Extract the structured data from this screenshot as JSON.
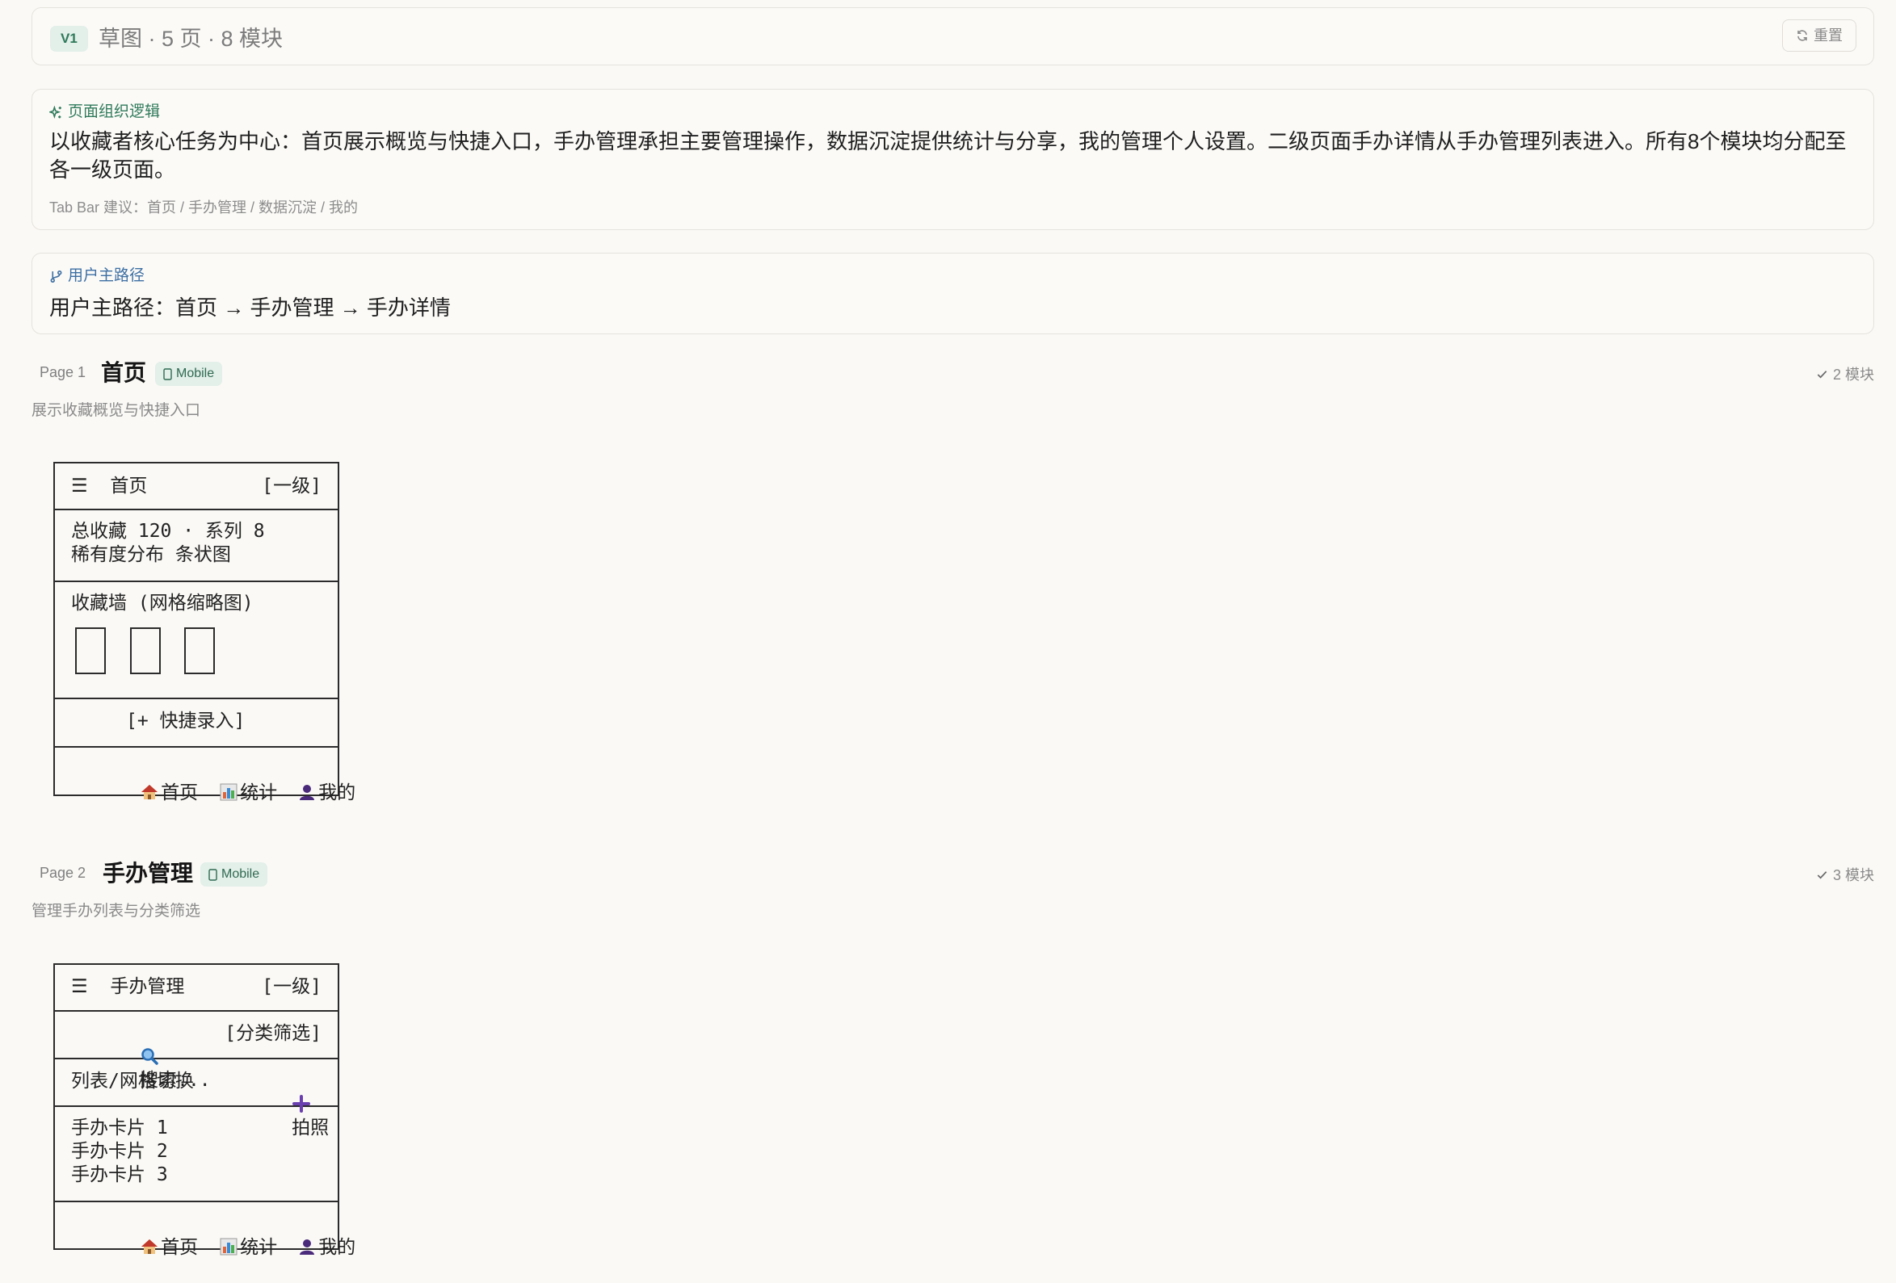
{
  "topbar": {
    "version": "V1",
    "title": "草图 · 5 页 · 8 模块",
    "reset_label": "重置"
  },
  "logic": {
    "heading": "页面组织逻辑",
    "body": "以收藏者核心任务为中心：首页展示概览与快捷入口，手办管理承担主要管理操作，数据沉淀提供统计与分享，我的管理个人设置。二级页面手办详情从手办管理列表进入。所有8个模块均分配至各一级页面。",
    "tab_hint": "Tab Bar 建议：首页 / 手办管理 / 数据沉淀 / 我的"
  },
  "user_path": {
    "heading": "用户主路径",
    "body": "用户主路径：首页 → 手办管理 → 手办详情"
  },
  "pages": [
    {
      "num": "Page 1",
      "name": "首页",
      "badge": "Mobile",
      "module_count": "2 模块",
      "desc": "展示收藏概览与快捷入口",
      "wire": {
        "header_title": "☰  首页",
        "header_level": "[一级]",
        "stats_line1": "总收藏 120 · 系列 8",
        "stats_line2": "稀有度分布 条状图",
        "wall_title": "收藏墙 (网格缩略图)",
        "quick_entry": "[+ 快捷录入]",
        "tab_home": "首页",
        "tab_stats": "统计",
        "tab_me": "我的"
      }
    },
    {
      "num": "Page 2",
      "name": "手办管理",
      "badge": "Mobile",
      "module_count": "3 模块",
      "desc": "管理手办列表与分类筛选",
      "wire": {
        "header_title": "☰  手办管理",
        "header_level": "[一级]",
        "search": "搜索...",
        "filter": "[分类筛选]",
        "toggle": "列表/网格切换",
        "photo": "拍照",
        "card1": "手办卡片 1",
        "card2": "手办卡片 2",
        "card3": "手办卡片 3",
        "tab_home": "首页",
        "tab_stats": "统计",
        "tab_me": "我的"
      }
    }
  ]
}
